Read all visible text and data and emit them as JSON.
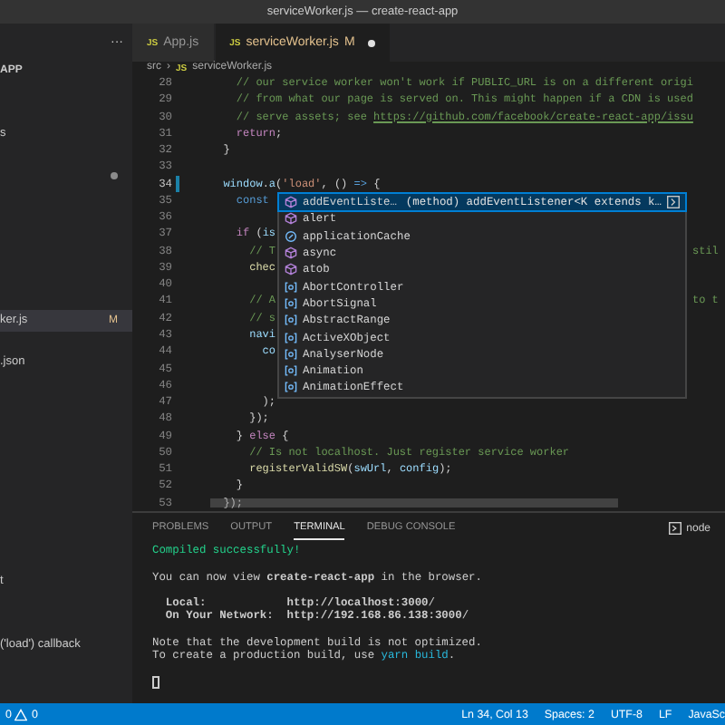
{
  "window": {
    "title": "serviceWorker.js — create-react-app"
  },
  "sidebar": {
    "more": "···",
    "header": "APP",
    "items": [
      {
        "kind": "file",
        "label": "s",
        "selected": false
      },
      {
        "kind": "dot",
        "selected": false
      },
      {
        "kind": "file",
        "label": "ker.js",
        "badge": "M",
        "selected": true
      },
      {
        "kind": "file",
        "label": ".json",
        "selected": false
      }
    ],
    "outline": [
      {
        "label": "t"
      },
      {
        "label": "('load') callback"
      }
    ]
  },
  "tabs": [
    {
      "label": "App.js",
      "icon": "JS",
      "selected": false,
      "modified": false
    },
    {
      "label": "serviceWorker.js",
      "icon": "JS",
      "badge": "M",
      "selected": true,
      "modified": true
    }
  ],
  "breadcrumb": {
    "folder": "src",
    "separator": "›",
    "icon": "JS",
    "file": "serviceWorker.js"
  },
  "editor": {
    "lines": [
      {
        "n": "28",
        "current": false,
        "changed": false,
        "tokens": [
          {
            "t": "    // our service worker won't work if PUBLIC_URL is on a different origi",
            "kind": "comment"
          }
        ]
      },
      {
        "n": "29",
        "current": false,
        "changed": false,
        "tokens": [
          {
            "t": "    // from what our page is served on. This might happen if a CDN is used",
            "kind": "comment"
          }
        ]
      },
      {
        "n": "30",
        "current": false,
        "changed": false,
        "tokens": [
          {
            "t": "    // serve assets; see ",
            "kind": "comment"
          },
          {
            "t": "https://github.com/facebook/create-react-app/issu",
            "kind": "link"
          }
        ]
      },
      {
        "n": "31",
        "current": false,
        "changed": false,
        "tokens": [
          {
            "t": "    return",
            "kind": "keyword"
          },
          {
            "t": ";",
            "kind": "punct"
          }
        ]
      },
      {
        "n": "32",
        "current": false,
        "changed": false,
        "tokens": [
          {
            "t": "  }",
            "kind": "punct"
          }
        ]
      },
      {
        "n": "33",
        "current": false,
        "changed": false
      },
      {
        "n": "34",
        "current": true,
        "changed": true,
        "tokens": [
          {
            "t": "  window",
            "kind": "var"
          },
          {
            "t": ".",
            "kind": "punct"
          },
          {
            "t": "a",
            "kind": "var"
          },
          {
            "t": "(",
            "kind": "punct"
          },
          {
            "t": "'load'",
            "kind": "string"
          },
          {
            "t": ", () ",
            "kind": "punct"
          },
          {
            "t": "=>",
            "kind": "storage"
          },
          {
            "t": " {",
            "kind": "punct"
          }
        ]
      },
      {
        "n": "35",
        "current": false,
        "changed": false,
        "tokens": [
          {
            "t": "    const",
            "kind": "storage"
          }
        ]
      },
      {
        "n": "36",
        "current": false,
        "changed": false
      },
      {
        "n": "37",
        "current": false,
        "changed": false,
        "tokens": [
          {
            "t": "    if",
            "kind": "keyword"
          },
          {
            "t": " (",
            "kind": "punct"
          },
          {
            "t": "is",
            "kind": "var"
          }
        ]
      },
      {
        "n": "38",
        "current": false,
        "changed": false,
        "tokens": [
          {
            "t": "      // T",
            "kind": "comment"
          }
        ],
        "tail": {
          "t": "stil",
          "kind": "comment"
        }
      },
      {
        "n": "39",
        "current": false,
        "changed": false,
        "tokens": [
          {
            "t": "      chec",
            "kind": "fn"
          }
        ]
      },
      {
        "n": "40",
        "current": false,
        "changed": false
      },
      {
        "n": "41",
        "current": false,
        "changed": false,
        "tokens": [
          {
            "t": "      // A",
            "kind": "comment"
          }
        ],
        "tail": {
          "t": "to t",
          "kind": "comment"
        }
      },
      {
        "n": "42",
        "current": false,
        "changed": false,
        "tokens": [
          {
            "t": "      // s",
            "kind": "comment"
          }
        ]
      },
      {
        "n": "43",
        "current": false,
        "changed": false,
        "tokens": [
          {
            "t": "      navi",
            "kind": "var"
          }
        ]
      },
      {
        "n": "44",
        "current": false,
        "changed": false,
        "tokens": [
          {
            "t": "        co",
            "kind": "var"
          }
        ]
      },
      {
        "n": "45",
        "current": false,
        "changed": false
      },
      {
        "n": "46",
        "current": false,
        "changed": false
      },
      {
        "n": "47",
        "current": false,
        "changed": false,
        "tokens": [
          {
            "t": "        );",
            "kind": "punct"
          }
        ]
      },
      {
        "n": "48",
        "current": false,
        "changed": false,
        "tokens": [
          {
            "t": "      });",
            "kind": "punct"
          }
        ]
      },
      {
        "n": "49",
        "current": false,
        "changed": false,
        "tokens": [
          {
            "t": "    } ",
            "kind": "punct"
          },
          {
            "t": "else",
            "kind": "keyword"
          },
          {
            "t": " {",
            "kind": "punct"
          }
        ]
      },
      {
        "n": "50",
        "current": false,
        "changed": false,
        "tokens": [
          {
            "t": "      // Is not localhost. Just register service worker",
            "kind": "comment"
          }
        ]
      },
      {
        "n": "51",
        "current": false,
        "changed": false,
        "tokens": [
          {
            "t": "      registerValidSW",
            "kind": "fn"
          },
          {
            "t": "(",
            "kind": "punct"
          },
          {
            "t": "swUrl",
            "kind": "var"
          },
          {
            "t": ", ",
            "kind": "punct"
          },
          {
            "t": "config",
            "kind": "var"
          },
          {
            "t": ");",
            "kind": "punct"
          }
        ]
      },
      {
        "n": "52",
        "current": false,
        "changed": false,
        "tokens": [
          {
            "t": "    }",
            "kind": "punct"
          }
        ]
      },
      {
        "n": "53",
        "current": false,
        "changed": false,
        "tokens": [
          {
            "t": "  });",
            "kind": "punct"
          }
        ]
      }
    ],
    "suggestions": [
      {
        "label": "addEventListe…",
        "kind": "method",
        "selected": true,
        "detail": "(method) addEventListener<K extends k…"
      },
      {
        "label": "alert",
        "kind": "method",
        "selected": false
      },
      {
        "label": "applicationCache",
        "kind": "property",
        "selected": false
      },
      {
        "label": "async",
        "kind": "method",
        "selected": false
      },
      {
        "label": "atob",
        "kind": "method",
        "selected": false
      },
      {
        "label": "AbortController",
        "kind": "variable",
        "selected": false
      },
      {
        "label": "AbortSignal",
        "kind": "variable",
        "selected": false
      },
      {
        "label": "AbstractRange",
        "kind": "variable",
        "selected": false
      },
      {
        "label": "ActiveXObject",
        "kind": "variable",
        "selected": false
      },
      {
        "label": "AnalyserNode",
        "kind": "variable",
        "selected": false
      },
      {
        "label": "Animation",
        "kind": "variable",
        "selected": false
      },
      {
        "label": "AnimationEffect",
        "kind": "variable",
        "selected": false
      }
    ]
  },
  "panel": {
    "tabs": [
      {
        "label": "PROBLEMS",
        "selected": false
      },
      {
        "label": "OUTPUT",
        "selected": false
      },
      {
        "label": "TERMINAL",
        "selected": true
      },
      {
        "label": "DEBUG CONSOLE",
        "selected": false
      }
    ],
    "shell": "node",
    "paragraphs": [
      [
        [
          {
            "t": "Compiled successfully!",
            "kind": "success"
          }
        ]
      ],
      [
        [
          {
            "t": "You can now view ",
            "kind": "plain"
          },
          {
            "t": "create-react-app",
            "kind": "bold"
          },
          {
            "t": " in the browser.",
            "kind": "plain"
          }
        ]
      ],
      [
        [
          {
            "t": "  Local:            http://localhost:",
            "kind": "bold"
          },
          {
            "t": "3000",
            "kind": "bold"
          },
          {
            "t": "/",
            "kind": "plain"
          }
        ],
        [
          {
            "t": "  On Your Network:  http://192.168.86.138:",
            "kind": "bold"
          },
          {
            "t": "3000",
            "kind": "bold"
          },
          {
            "t": "/",
            "kind": "plain"
          }
        ]
      ],
      [
        [
          {
            "t": "Note that the development build is not optimized.",
            "kind": "plain"
          }
        ],
        [
          {
            "t": "To create a production build, use ",
            "kind": "plain"
          },
          {
            "t": "yarn build",
            "kind": "command"
          },
          {
            "t": ".",
            "kind": "plain"
          }
        ]
      ]
    ],
    "cursor": true
  },
  "status_bar": {
    "errors": "0",
    "warnings": "0",
    "items": [
      "Ln 34, Col 13",
      "Spaces: 2",
      "UTF-8",
      "LF",
      "JavaSc"
    ]
  }
}
